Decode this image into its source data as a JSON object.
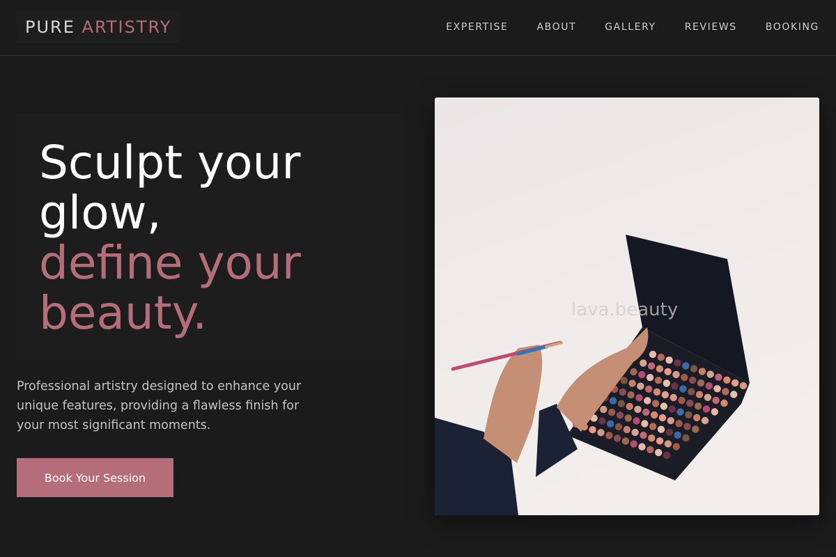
{
  "brand": {
    "name_part1": "PURE",
    "name_part2": "ARTISTRY"
  },
  "nav": {
    "items": [
      {
        "label": "EXPERTISE"
      },
      {
        "label": "ABOUT"
      },
      {
        "label": "GALLERY"
      },
      {
        "label": "REVIEWS"
      },
      {
        "label": "BOOKING"
      }
    ]
  },
  "hero": {
    "headline_line1": "Sculpt your",
    "headline_line2": "glow,",
    "headline_accent_line1": "define your",
    "headline_accent_line2": "beauty.",
    "description": "Professional artistry designed to enhance your unique features, providing a flawless finish for your most significant moments.",
    "cta_label": "Book Your Session"
  },
  "image": {
    "watermark": "lava.beauty"
  },
  "colors": {
    "background": "#1b1b1c",
    "accent": "#b56d7a",
    "text_primary": "#ffffff",
    "text_secondary": "#c4c4c4"
  }
}
